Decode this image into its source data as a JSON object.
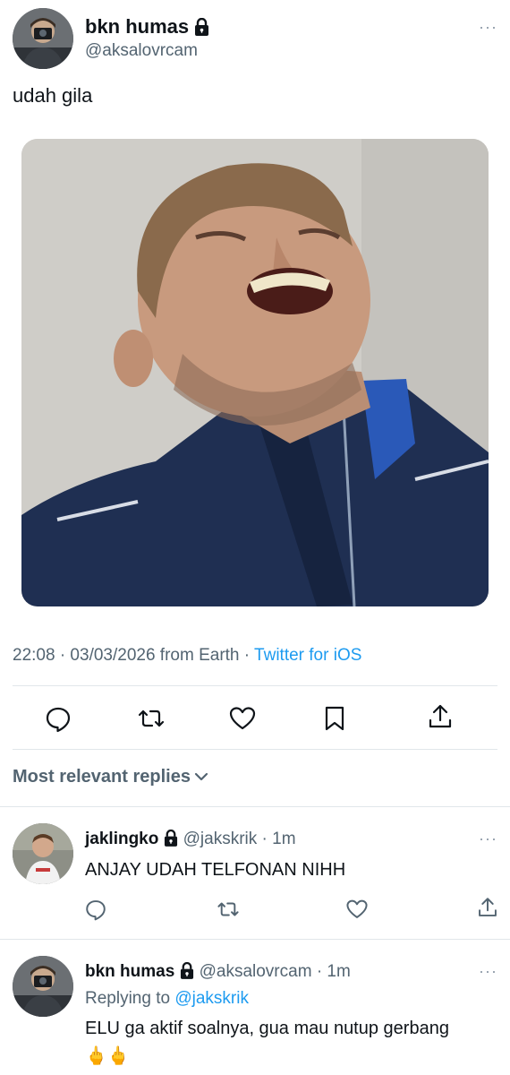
{
  "tweet": {
    "author_name": "bkn humas",
    "author_handle": "@aksalovrcam",
    "text": "udah gila",
    "timestamp": "22:08 · 03/03/2026 from Earth",
    "dot": "·",
    "source": "Twitter for iOS",
    "more": "···"
  },
  "actions": {
    "icons": [
      "reply-icon",
      "retweet-icon",
      "like-icon",
      "bookmark-icon",
      "share-icon"
    ]
  },
  "replies_header": {
    "label": "Most relevant replies"
  },
  "replies": [
    {
      "name": "jaklingko",
      "handle": "@jakskrik",
      "time": "· 1m",
      "text": "ANJAY UDAH TELFONAN NIHH",
      "more": "···"
    },
    {
      "name": "bkn humas",
      "handle": "@aksalovrcam",
      "time": "· 1m",
      "replying_prefix": "Replying to",
      "replying_to": "@jakskrik",
      "text": "ELU ga aktif soalnya, gua mau nutup gerbang",
      "emoji": "🖕🖕",
      "more": "···"
    }
  ],
  "colors": {
    "link": "#1d9bf0",
    "muted": "#536471",
    "text": "#0f1419",
    "divider": "#e1e6ea"
  }
}
